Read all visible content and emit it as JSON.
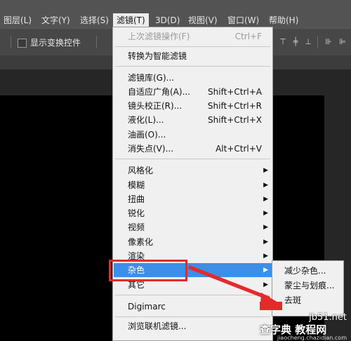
{
  "menubar": {
    "items": [
      {
        "label": "图层(L)"
      },
      {
        "label": "文字(Y)"
      },
      {
        "label": "选择(S)"
      },
      {
        "label": "滤镜(T)"
      },
      {
        "label": "3D(D)"
      },
      {
        "label": "视图(V)"
      },
      {
        "label": "窗口(W)"
      },
      {
        "label": "帮助(H)"
      }
    ]
  },
  "options": {
    "show_transform_controls": "显示变换控件"
  },
  "filter_menu": {
    "last_filter": {
      "label": "上次滤镜操作(F)",
      "shortcut": "Ctrl+F"
    },
    "convert_smart": {
      "label": "转换为智能滤镜"
    },
    "gallery": {
      "label": "滤镜库(G)..."
    },
    "adaptive_wide": {
      "label": "自适应广角(A)...",
      "shortcut": "Shift+Ctrl+A"
    },
    "lens_correction": {
      "label": "镜头校正(R)...",
      "shortcut": "Shift+Ctrl+R"
    },
    "liquify": {
      "label": "液化(L)...",
      "shortcut": "Shift+Ctrl+X"
    },
    "oil_paint": {
      "label": "油画(O)..."
    },
    "vanishing_point": {
      "label": "消失点(V)...",
      "shortcut": "Alt+Ctrl+V"
    },
    "stylize": {
      "label": "风格化"
    },
    "blur": {
      "label": "模糊"
    },
    "distort": {
      "label": "扭曲"
    },
    "sharpen": {
      "label": "锐化"
    },
    "video": {
      "label": "视频"
    },
    "pixelate": {
      "label": "像素化"
    },
    "render": {
      "label": "渲染"
    },
    "noise": {
      "label": "杂色"
    },
    "other": {
      "label": "其它"
    },
    "digimarc": {
      "label": "Digimarc"
    },
    "browse_online": {
      "label": "浏览联机滤镜..."
    }
  },
  "noise_submenu": {
    "reduce_noise": "减少杂色...",
    "dust_scratches": "蒙尘与划痕...",
    "despeckle": "去斑"
  },
  "colors": {
    "highlight": "#3d8ee8",
    "annotation_red": "#e52a2a"
  },
  "watermark": {
    "line1": "jb51.net",
    "line2": "查字典 教程网",
    "line3": "jiaocheng.chazidian.com"
  }
}
